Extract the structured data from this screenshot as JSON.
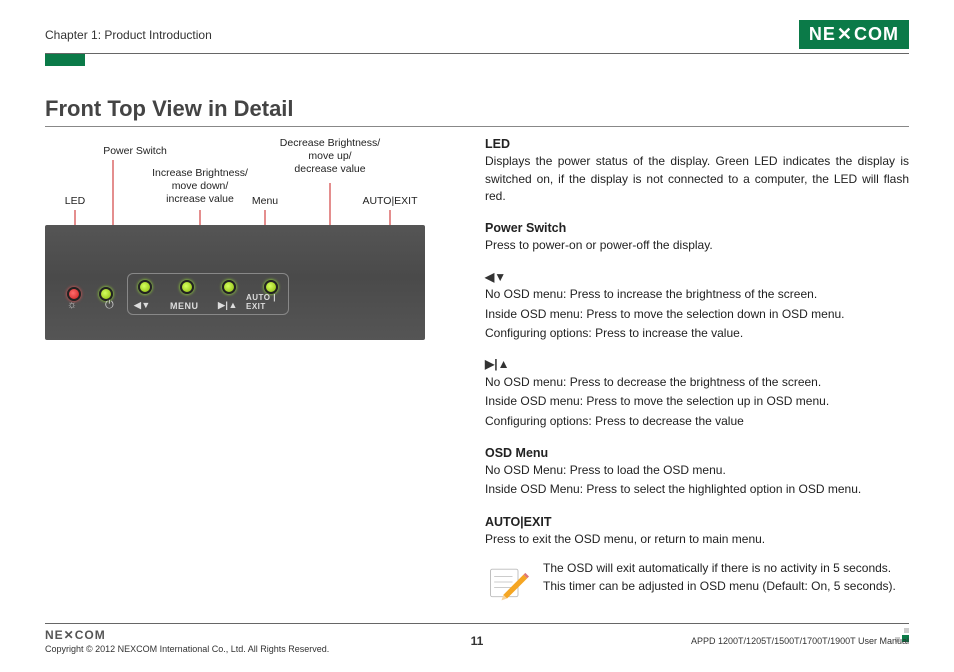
{
  "header": {
    "chapter": "Chapter 1: Product Introduction",
    "logo": "NEXCOM"
  },
  "title": "Front Top View in Detail",
  "diagram": {
    "labels": {
      "led": "LED",
      "power_switch": "Power Switch",
      "increase": "Increase Brightness/\nmove down/\nincrease value",
      "menu": "Menu",
      "decrease": "Decrease Brightness/\nmove up/\ndecrease value",
      "autoexit": "AUTO|EXIT"
    },
    "panel_buttons": {
      "menu_text": "MENU",
      "autoexit_text": "AUTO | EXIT",
      "left_arrows": "◀▼",
      "right_arrows": "▶|▲"
    }
  },
  "sections": {
    "led": {
      "heading": "LED",
      "body": "Displays the power status of the display. Green LED indicates the display is switched on, if the display is not connected to a computer, the LED will flash red."
    },
    "power_switch": {
      "heading": "Power Switch",
      "body": "Press to power-on or power-off the display."
    },
    "left_arrow": {
      "symbol": "◀▼",
      "l1": "No OSD menu: Press to increase the brightness of the screen.",
      "l2": "Inside OSD menu: Press to move the selection down in OSD menu.",
      "l3": "Configuring options: Press to increase the value."
    },
    "right_arrow": {
      "symbol": "▶|▲",
      "l1": "No OSD menu: Press to decrease the brightness of the screen.",
      "l2": "Inside OSD menu: Press to move the selection up in OSD menu.",
      "l3": "Configuring options: Press to decrease the value"
    },
    "osd_menu": {
      "heading": "OSD Menu",
      "l1": "No OSD Menu: Press to load the OSD menu.",
      "l2": "Inside OSD Menu: Press to select the highlighted option in OSD menu."
    },
    "autoexit": {
      "heading": "AUTO|EXIT",
      "body": "Press to exit the OSD menu, or return to main menu."
    },
    "note": "The OSD will exit automatically if there is no activity in 5 seconds. This timer can be adjusted in OSD menu (Default: On, 5 seconds)."
  },
  "footer": {
    "logo": "NE✕COM",
    "copyright": "Copyright © 2012 NEXCOM International Co., Ltd. All Rights Reserved.",
    "page": "11",
    "manual": "APPD 1200T/1205T/1500T/1700T/1900T User Manual"
  }
}
